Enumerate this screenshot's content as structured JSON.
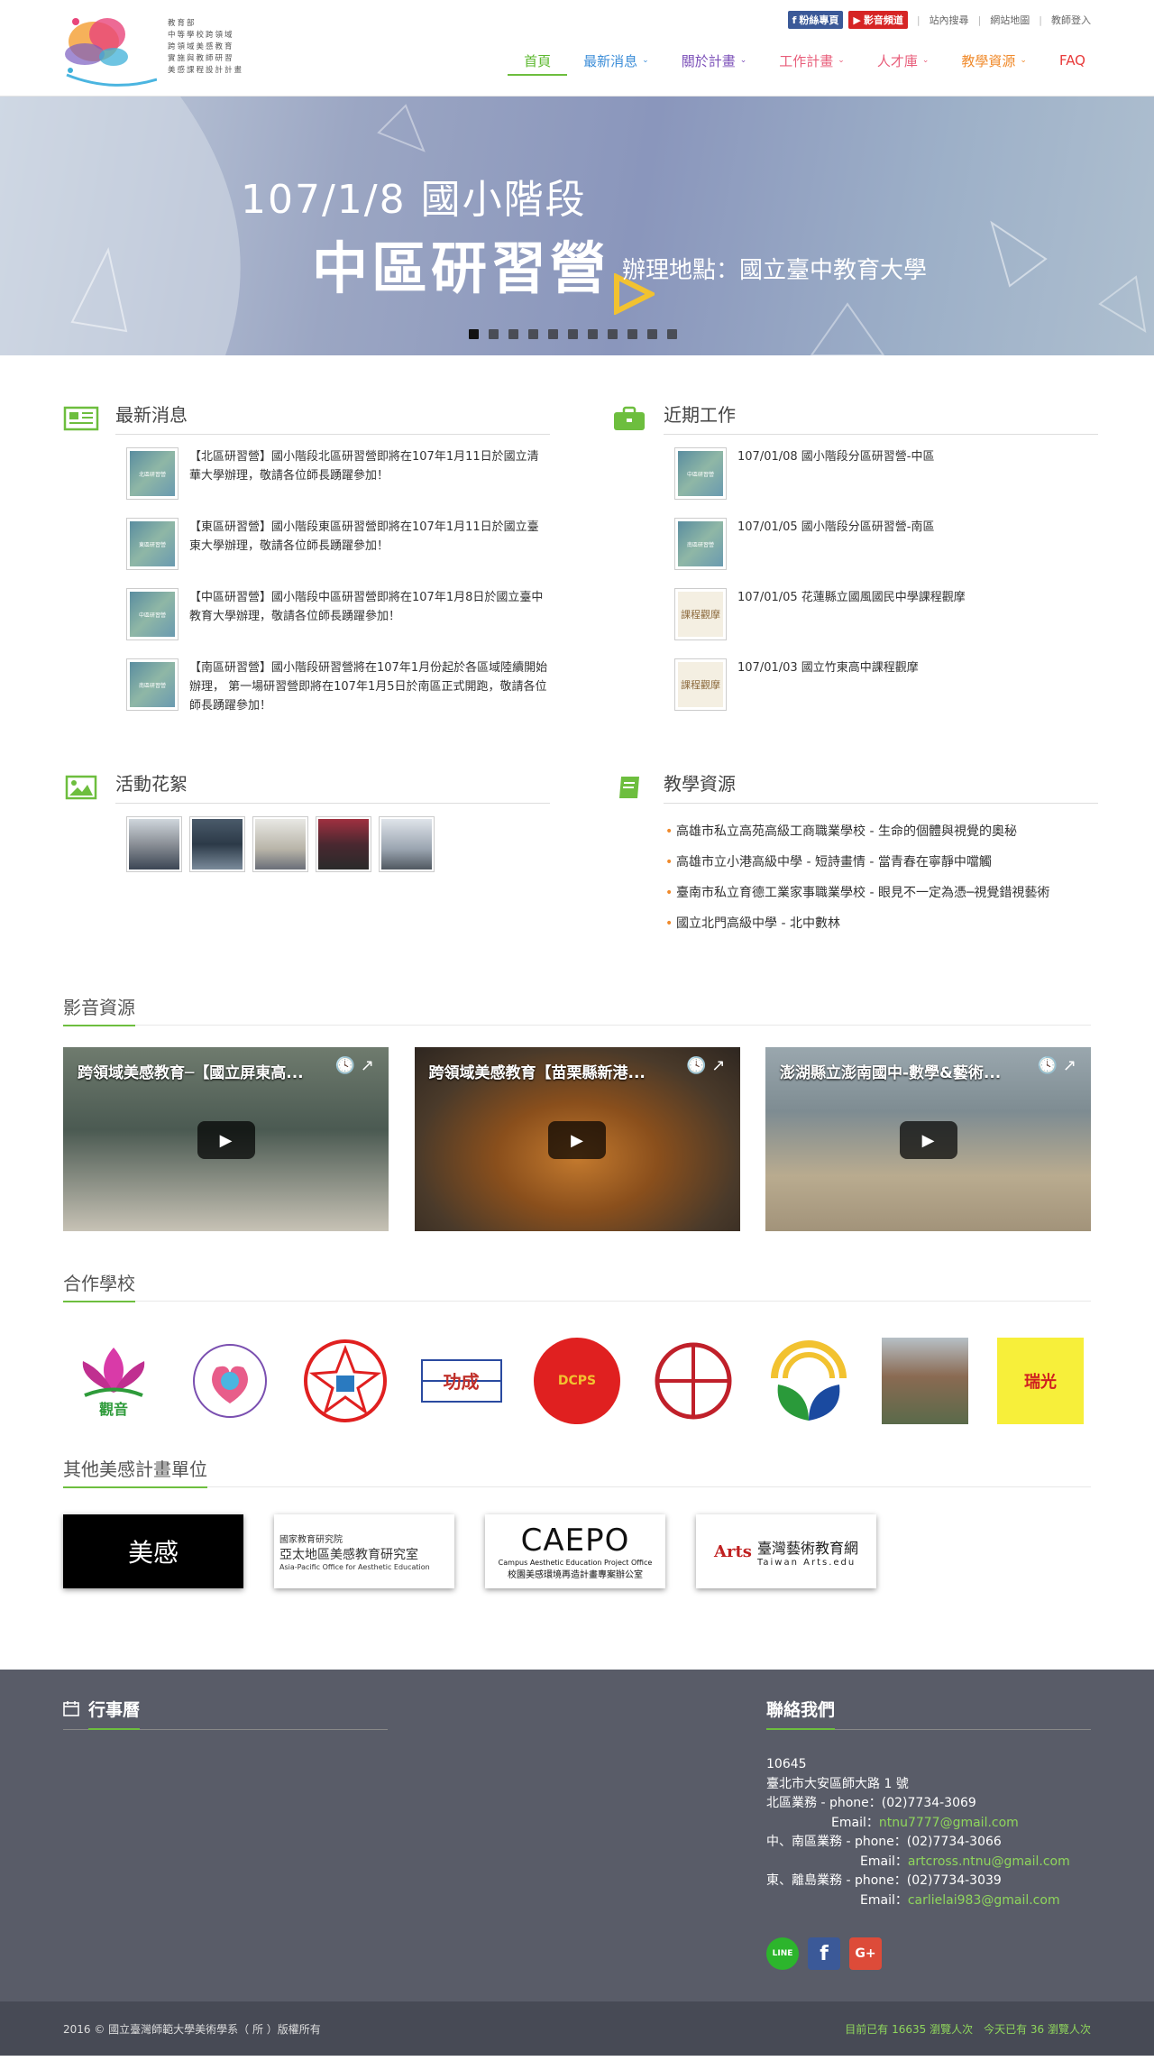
{
  "header": {
    "logo_lines": [
      "教育部",
      "中等學校跨領域",
      "跨領域美感教育",
      "實施與教師研習",
      "美感課程設計計畫"
    ],
    "top_links": {
      "fb": "粉絲專頁",
      "yt": "影音頻道",
      "search": "站內搜尋",
      "sitemap": "網站地圖",
      "login": "教師登入"
    },
    "nav": [
      {
        "label": "首頁",
        "color": "#5cb82f",
        "dropdown": false
      },
      {
        "label": "最新消息",
        "color": "#3d8ed8",
        "dropdown": true
      },
      {
        "label": "關於計畫",
        "color": "#7b4fb8",
        "dropdown": true
      },
      {
        "label": "工作計畫",
        "color": "#e85d7a",
        "dropdown": true
      },
      {
        "label": "人才庫",
        "color": "#e85d7a",
        "dropdown": true
      },
      {
        "label": "教學資源",
        "color": "#f08a2b",
        "dropdown": true
      },
      {
        "label": "FAQ",
        "color": "#e83b3b",
        "dropdown": false
      }
    ]
  },
  "hero": {
    "line1": "107/1/8 國小階段",
    "line2": "中區研習營",
    "line3": "辦理地點：國立臺中教育大學",
    "slides": 11,
    "active": 0
  },
  "news": {
    "title": "最新消息",
    "items": [
      {
        "text": "【北區研習營】國小階段北區研習營即將在107年1月11日於國立清華大學辦理，敬請各位師長踴躍參加！",
        "thumb": "北區研習營"
      },
      {
        "text": "【東區研習營】國小階段東區研習營即將在107年1月11日於國立臺東大學辦理，敬請各位師長踴躍參加！",
        "thumb": "東區研習營"
      },
      {
        "text": "【中區研習營】國小階段中區研習營即將在107年1月8日於國立臺中教育大學辦理，敬請各位師長踴躍參加！",
        "thumb": "中區研習營"
      },
      {
        "text": "【南區研習營】國小階段研習營將在107年1月份起於各區域陸續開始辦理， 第一場研習營即將在107年1月5日於南區正式開跑，敬請各位師長踴躍參加！",
        "thumb": "南區研習營"
      }
    ]
  },
  "recent": {
    "title": "近期工作",
    "items": [
      {
        "text": "107/01/08 國小階段分區研習營-中區",
        "thumb": "中區研習營"
      },
      {
        "text": "107/01/05 國小階段分區研習營-南區",
        "thumb": "南區研習營"
      },
      {
        "text": "107/01/05 花蓮縣立國風國民中學課程觀摩",
        "thumb": "課程觀摩"
      },
      {
        "text": "107/01/03 國立竹東高中課程觀摩",
        "thumb": "課程觀摩"
      }
    ]
  },
  "gallery": {
    "title": "活動花絮"
  },
  "resources": {
    "title": "教學資源",
    "items": [
      "高雄市私立高苑高級工商職業學校 - 生命的個體與視覺的奧秘",
      "高雄市立小港高級中學 - 短詩畫情 - 當青春在寧靜中噹觸",
      "臺南市私立育德工業家事職業學校 - 眼見不一定為憑─視覺錯視藝術",
      "國立北門高級中學 - 北中數林"
    ]
  },
  "videos": {
    "title": "影音資源",
    "items": [
      {
        "title": "跨領域美感教育─【國立屏東高..."
      },
      {
        "title": "跨領域美感教育【苗栗縣新港..."
      },
      {
        "title": "澎湖縣立澎南國中-數學&藝術..."
      }
    ]
  },
  "schools": {
    "title": "合作學校",
    "logos": [
      "觀音",
      "",
      "",
      "功成",
      "DCPS",
      "",
      "",
      "",
      "瑞光"
    ]
  },
  "partners": {
    "title": "其他美感計畫單位",
    "items": [
      {
        "main": "美感",
        "sub": ""
      },
      {
        "main": "亞太地區美感教育研究室",
        "sub": "國家教育研究院",
        "en": "Asia-Pacific Office for Aesthetic Education"
      },
      {
        "main": "CAEPO",
        "sub": "Campus Aesthetic Education Project Office",
        "zh": "校園美感環境再造計畫專案辦公室"
      },
      {
        "main": "臺灣藝術教育網",
        "sub": "Taiwan Arts.edu",
        "art": "Arts"
      }
    ]
  },
  "footer": {
    "calendar_title": "行事曆",
    "contact_title": "聯絡我們",
    "postal": "10645",
    "address": "臺北市大安區師大路 1 號",
    "north": "北區業務 - phone：(02)7734-3069",
    "north_email": "ntnu7777@gmail.com",
    "mid": "中、南區業務 - phone：(02)7734-3066",
    "mid_email": "artcross.ntnu@gmail.com",
    "east": "東、離島業務 - phone：(02)7734-3039",
    "east_email": "carlielai983@gmail.com",
    "email_label": "Email：",
    "social": {
      "line": "LINE",
      "fb": "f",
      "gplus": "G+"
    },
    "copyright": "2016 © 國立臺灣師範大學美術學系（ 所 ）版權所有",
    "stats": "目前已有 16635 瀏覽人次　今天已有 36 瀏覽人次"
  }
}
